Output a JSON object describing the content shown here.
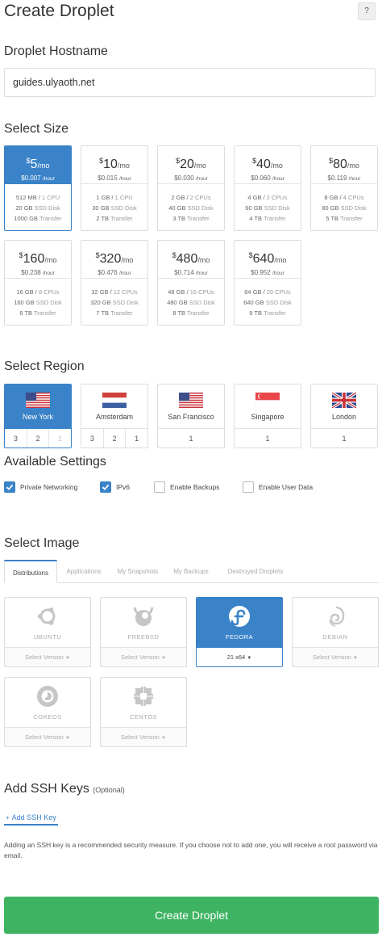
{
  "header": {
    "title": "Create Droplet",
    "help_label": "?"
  },
  "hostname": {
    "section_title": "Droplet Hostname",
    "value": "guides.ulyaoth.net"
  },
  "size": {
    "section_title": "Select Size",
    "plans": [
      {
        "dollar": "$",
        "price": "5",
        "per_month": "/mo",
        "hourly": "$0.007",
        "per_hour": "/hour",
        "memory": "512 MB",
        "cpu": "1 CPU",
        "disk": "20 GB",
        "disk_type": "SSD Disk",
        "transfer": "1000 GB",
        "transfer_label": "Transfer",
        "selected": true
      },
      {
        "dollar": "$",
        "price": "10",
        "per_month": "/mo",
        "hourly": "$0.015",
        "per_hour": "/hour",
        "memory": "1 GB",
        "cpu": "1 CPU",
        "disk": "30 GB",
        "disk_type": "SSD Disk",
        "transfer": "2 TB",
        "transfer_label": "Transfer",
        "selected": false
      },
      {
        "dollar": "$",
        "price": "20",
        "per_month": "/mo",
        "hourly": "$0.030",
        "per_hour": "/hour",
        "memory": "2 GB",
        "cpu": "2 CPUs",
        "disk": "40 GB",
        "disk_type": "SSD Disk",
        "transfer": "3 TB",
        "transfer_label": "Transfer",
        "selected": false
      },
      {
        "dollar": "$",
        "price": "40",
        "per_month": "/mo",
        "hourly": "$0.060",
        "per_hour": "/hour",
        "memory": "4 GB",
        "cpu": "2 CPUs",
        "disk": "60 GB",
        "disk_type": "SSD Disk",
        "transfer": "4 TB",
        "transfer_label": "Transfer",
        "selected": false
      },
      {
        "dollar": "$",
        "price": "80",
        "per_month": "/mo",
        "hourly": "$0.119",
        "per_hour": "/hour",
        "memory": "8 GB",
        "cpu": "4 CPUs",
        "disk": "80 GB",
        "disk_type": "SSD Disk",
        "transfer": "5 TB",
        "transfer_label": "Transfer",
        "selected": false
      },
      {
        "dollar": "$",
        "price": "160",
        "per_month": "/mo",
        "hourly": "$0.238",
        "per_hour": "/hour",
        "memory": "16 GB",
        "cpu": "8 CPUs",
        "disk": "160 GB",
        "disk_type": "SSD Disk",
        "transfer": "6 TB",
        "transfer_label": "Transfer",
        "selected": false
      },
      {
        "dollar": "$",
        "price": "320",
        "per_month": "/mo",
        "hourly": "$0.476",
        "per_hour": "/hour",
        "memory": "32 GB",
        "cpu": "12 CPUs",
        "disk": "320 GB",
        "disk_type": "SSD Disk",
        "transfer": "7 TB",
        "transfer_label": "Transfer",
        "selected": false
      },
      {
        "dollar": "$",
        "price": "480",
        "per_month": "/mo",
        "hourly": "$0.714",
        "per_hour": "/hour",
        "memory": "48 GB",
        "cpu": "16 CPUs",
        "disk": "480 GB",
        "disk_type": "SSD Disk",
        "transfer": "8 TB",
        "transfer_label": "Transfer",
        "selected": false
      },
      {
        "dollar": "$",
        "price": "640",
        "per_month": "/mo",
        "hourly": "$0.952",
        "per_hour": "/hour",
        "memory": "64 GB",
        "cpu": "20 CPUs",
        "disk": "640 GB",
        "disk_type": "SSD Disk",
        "transfer": "9 TB",
        "transfer_label": "Transfer",
        "selected": false
      }
    ]
  },
  "region": {
    "section_title": "Select Region",
    "regions": [
      {
        "name": "New York",
        "flag": "us-flag-icon",
        "datacenters": [
          "3",
          "2",
          "1"
        ],
        "selected_datacenter": "3",
        "unavailable_datacenters": [
          "1"
        ],
        "selected": true
      },
      {
        "name": "Amsterdam",
        "flag": "nl-flag-icon",
        "datacenters": [
          "3",
          "2",
          "1"
        ],
        "selected": false
      },
      {
        "name": "San Francisco",
        "flag": "us-flag-icon",
        "datacenters": [
          "1"
        ],
        "selected": false
      },
      {
        "name": "Singapore",
        "flag": "sg-flag-icon",
        "datacenters": [
          "1"
        ],
        "selected": false
      },
      {
        "name": "London",
        "flag": "uk-flag-icon",
        "datacenters": [
          "1"
        ],
        "selected": false
      }
    ]
  },
  "settings": {
    "section_title": "Available Settings",
    "options": [
      {
        "label": "Private Networking",
        "checked": true
      },
      {
        "label": "IPv6",
        "checked": true
      },
      {
        "label": "Enable Backups",
        "checked": false
      },
      {
        "label": "Enable User Data",
        "checked": false
      }
    ]
  },
  "image": {
    "section_title": "Select Image",
    "tabs": [
      "Distributions",
      "Applications",
      "My Snapshots",
      "My Backups",
      "Destroyed Droplets"
    ],
    "active_tab": "Distributions",
    "distros": [
      {
        "name": "UBUNTU",
        "icon": "ubuntu-icon",
        "version": "Select Version",
        "selected": false
      },
      {
        "name": "FREEBSD",
        "icon": "freebsd-icon",
        "version": "Select Version",
        "selected": false
      },
      {
        "name": "FEDORA",
        "icon": "fedora-icon",
        "version": "21 x64",
        "selected": true
      },
      {
        "name": "DEBIAN",
        "icon": "debian-icon",
        "version": "Select Version",
        "selected": false
      },
      {
        "name": "COREOS",
        "icon": "coreos-icon",
        "version": "Select Version",
        "selected": false
      },
      {
        "name": "CENTOS",
        "icon": "centos-icon",
        "version": "Select Version",
        "selected": false
      }
    ]
  },
  "ssh": {
    "section_title": "Add SSH Keys",
    "optional_label": "(Optional)",
    "add_label": "Add SSH Key",
    "add_plus": "+",
    "note": "Adding an SSH key is a recommended security measure. If you choose not to add one, you will receive a root password via email."
  },
  "actions": {
    "create_label": "Create Droplet"
  },
  "colors": {
    "accent": "#3a83c8",
    "create_button": "#3eb463"
  }
}
